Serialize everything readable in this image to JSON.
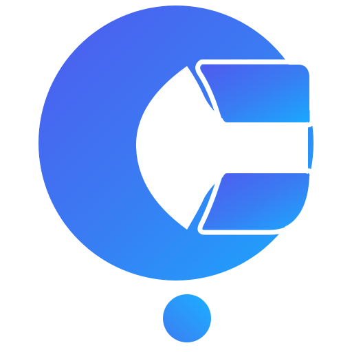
{
  "logo": {
    "icon_name": "c-letter-logo-icon",
    "dot_icon_name": "dot-icon",
    "colors": {
      "gradient_start": "#4F5AEE",
      "gradient_mid": "#3A7BF2",
      "gradient_end": "#1AA8FF",
      "dot_start": "#3D7CF3",
      "dot_end": "#1AB0FF",
      "background": "#FFFFFF"
    }
  }
}
